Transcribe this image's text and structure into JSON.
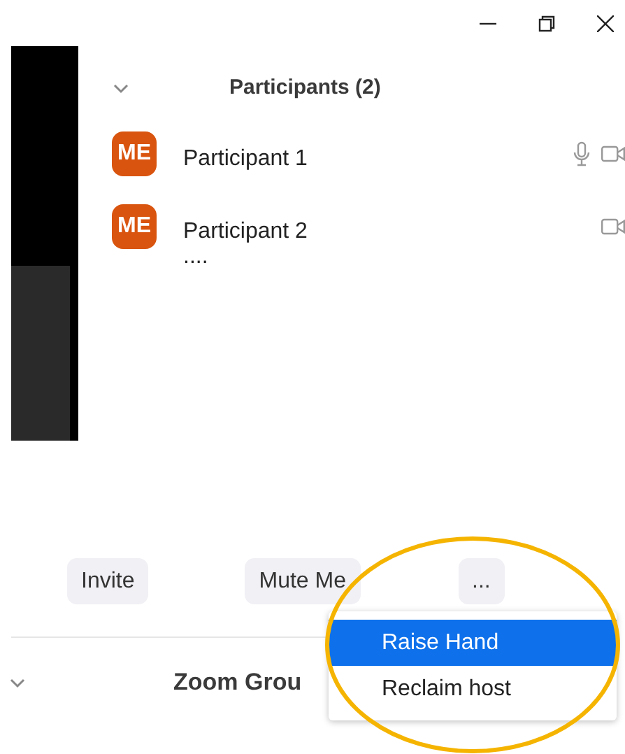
{
  "participants_panel": {
    "title": "Participants (2)",
    "participants": [
      {
        "initials": "ME",
        "name": "Participant 1",
        "mic": true,
        "video": true
      },
      {
        "initials": "ME",
        "name": "Participant 2",
        "mic": false,
        "video": true
      }
    ],
    "more_text": "...."
  },
  "buttons": [
    {
      "label": "Invite"
    },
    {
      "label": "Mute Me"
    },
    {
      "label": "..."
    }
  ],
  "menu": [
    {
      "label": "Raise Hand",
      "selected": true
    },
    {
      "label": "Reclaim host",
      "selected": false
    }
  ],
  "chat_header": {
    "title": "Zoom Grou"
  }
}
